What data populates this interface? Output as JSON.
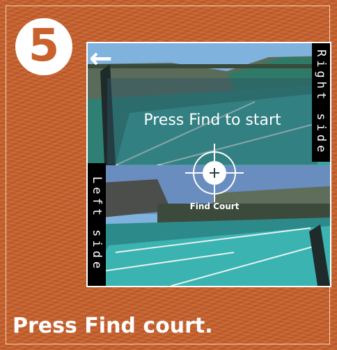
{
  "step": {
    "number": "5"
  },
  "screen": {
    "start_prompt": "Press Find to start",
    "right_side_label": "Right side",
    "left_side_label": "Left side",
    "find_button_label": "Find Court",
    "back_icon": "arrow-left-icon",
    "target_icon": "crosshair-icon"
  },
  "caption": "Press Find court.",
  "colors": {
    "background": "#c9612c",
    "badge": "#ffffff",
    "court": "#3aa5a5"
  }
}
